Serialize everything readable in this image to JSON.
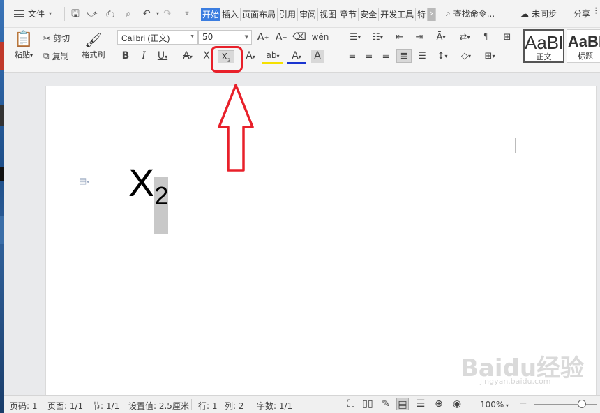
{
  "menu": {
    "file_label": "文件",
    "tabs": [
      "开始",
      "插入",
      "页面布局",
      "引用",
      "审阅",
      "视图",
      "章节",
      "安全",
      "开发工具",
      "特"
    ],
    "search_commands": "查找命令...",
    "sync_status": "未同步",
    "share_label": "分享"
  },
  "ribbon": {
    "paste_label": "粘贴",
    "cut_label": "剪切",
    "copy_label": "复制",
    "format_painter_label": "格式刷",
    "font_name": "Calibri (正文)",
    "font_size": "50",
    "styles": [
      {
        "sample": "AaBl",
        "label": "正文"
      },
      {
        "sample": "AaBl",
        "label": "标题"
      }
    ]
  },
  "document": {
    "text_main": "X",
    "text_subscript": "2"
  },
  "watermark": {
    "text": "Baidu经验",
    "sub": "jingyan.baidu.com"
  },
  "status": {
    "page_num": "页码: 1",
    "page_of": "页面: 1/1",
    "section": "节: 1/1",
    "setting_value": "设置值: 2.5厘米",
    "line": "行: 1",
    "column": "列: 2",
    "word_count": "字数: 1/1",
    "zoom": "100%"
  },
  "colors": {
    "accent_tab": "#3b7de0",
    "annotation_red": "#e8202a"
  }
}
